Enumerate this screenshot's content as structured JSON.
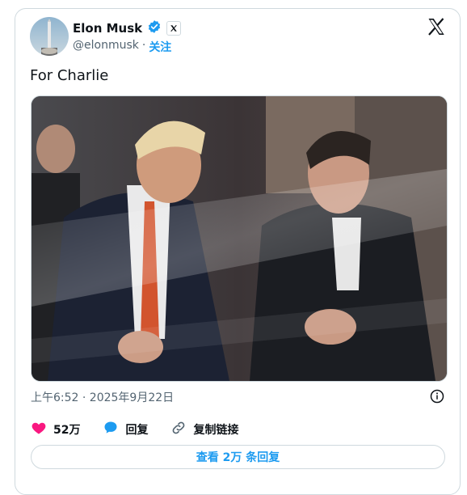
{
  "author": {
    "name": "Elon Musk",
    "handle": "@elonmusk",
    "separator": "·",
    "follow_label": "关注"
  },
  "tweet": {
    "text": "For Charlie",
    "timestamp": "上午6:52 · 2025年9月22日"
  },
  "actions": {
    "likes": "52万",
    "reply_label": "回复",
    "copy_link_label": "复制链接"
  },
  "replies_button": {
    "label": "查看 2万 条回复"
  },
  "colors": {
    "accent": "#1d9bf0",
    "like": "#f91880",
    "text": "#0f1419",
    "muted": "#536471",
    "border": "#cfd9de"
  },
  "icons": [
    "verified-badge-icon",
    "x-affiliate-icon",
    "x-logo-icon",
    "info-icon",
    "heart-icon",
    "reply-bubble-icon",
    "link-icon"
  ]
}
